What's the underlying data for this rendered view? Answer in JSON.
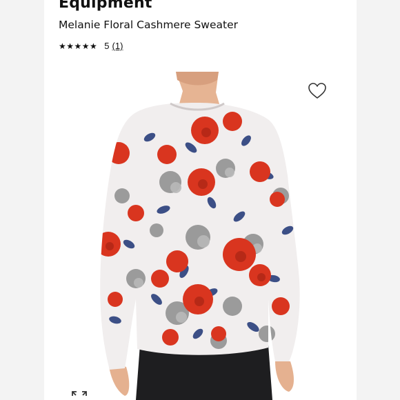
{
  "product": {
    "brand": "Equipment",
    "name": "Melanie Floral Cashmere Sweater",
    "stars": "★★★★★",
    "rating_value": "5",
    "review_count": "(1)"
  },
  "colors": {
    "sweater_base": "#f1eeee",
    "rose_red": "#d9351f",
    "leaf_blue": "#3c4f86",
    "leaf_gray": "#8c8c8c",
    "pants": "#1e1e20",
    "skin": "#e4b08e"
  },
  "icons": {
    "wishlist": "heart-icon",
    "zoom": "expand-icon"
  }
}
